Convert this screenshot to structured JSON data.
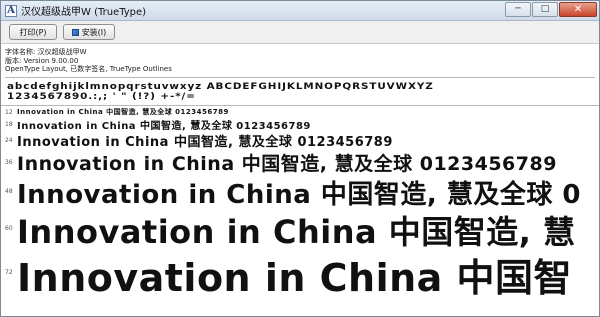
{
  "window": {
    "title": "汉仪超级战甲W (TrueType)",
    "controls": {
      "minimize": "─",
      "maximize": "□",
      "close": "✕"
    }
  },
  "toolbar": {
    "print_label": "打印(P)",
    "install_label": "安装(I)"
  },
  "font_info": {
    "name_line": "字体名称: 汉仪超级战甲W",
    "version_line": "版本: Version 9.00.00",
    "features_line": "OpenType Layout, 已数字签名, TrueType Outlines"
  },
  "charset": {
    "line1": "abcdefghijklmnopqrstuvwxyz ABCDEFGHIJKLMNOPQRSTUVWXYZ",
    "line2": "1234567890.:,; ' \" (!?) +-*/="
  },
  "samples": [
    {
      "size": "12",
      "text": "Innovation in China 中国智造, 慧及全球 0123456789"
    },
    {
      "size": "18",
      "text": "Innovation in China 中国智造, 慧及全球 0123456789"
    },
    {
      "size": "24",
      "text": "Innovation in China 中国智造, 慧及全球 0123456789"
    },
    {
      "size": "36",
      "text": "Innovation in China 中国智造, 慧及全球 0123456789"
    },
    {
      "size": "48",
      "text": "Innovation in China 中国智造, 慧及全球 0"
    },
    {
      "size": "60",
      "text": "Innovation in China 中国智造, 慧"
    },
    {
      "size": "72",
      "text": "Innovation in China 中国智"
    }
  ]
}
